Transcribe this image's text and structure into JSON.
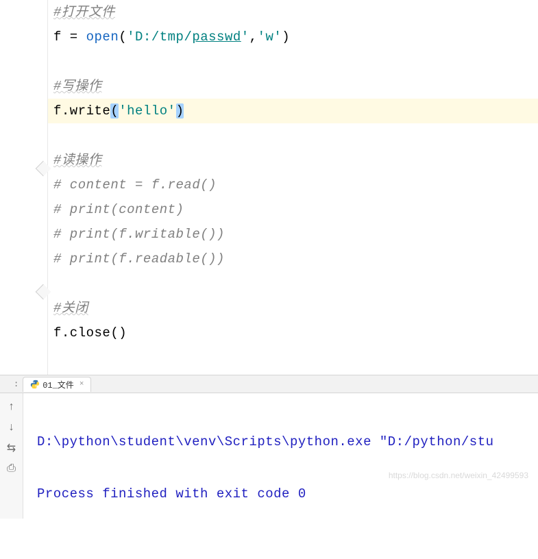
{
  "code": {
    "l1": "#打开文件",
    "l2_a": "f = ",
    "l2_open": "open",
    "l2_b": "(",
    "l2_s1a": "'D:/tmp/",
    "l2_s1b": "passwd",
    "l2_s1c": "'",
    "l2_c": ",",
    "l2_s2": "'w'",
    "l2_d": ")",
    "l3": "#写操作",
    "l4_a": "f.write",
    "l4_p1": "(",
    "l4_s": "'hello'",
    "l4_p2": ")",
    "l5": "#读操作",
    "l6": "# content = f.read()",
    "l7": "# print(content)",
    "l8": "# print(f.writable())",
    "l9": "# print(f.readable())",
    "l10": "#关闭",
    "l11": "f.close()"
  },
  "tab": {
    "run_label": ":",
    "name": "01_文件",
    "close": "×"
  },
  "console": {
    "line1": "D:\\python\\student\\venv\\Scripts\\python.exe \"D:/python/stu",
    "line2": "Process finished with exit code 0"
  },
  "icons": {
    "arrow_up": "↑",
    "arrow_down": "↓",
    "wrap": "⇆",
    "print": "⎙"
  },
  "watermark": "https://blog.csdn.net/weixin_42499593"
}
